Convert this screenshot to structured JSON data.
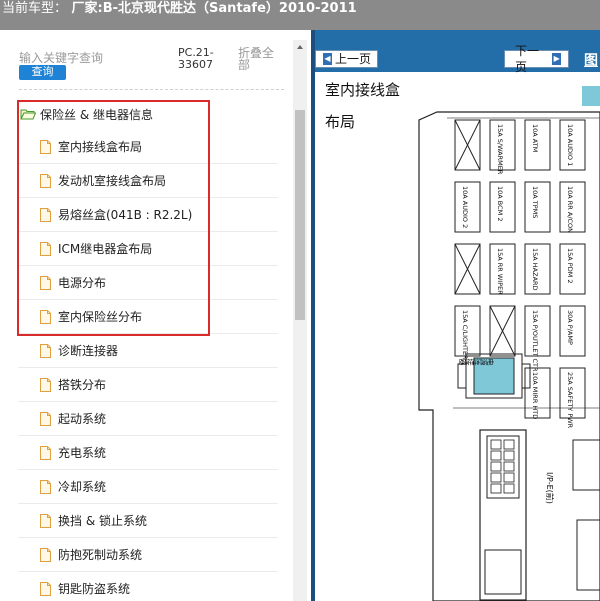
{
  "header": {
    "label": "当前车型：",
    "vehicle": "厂家:B-北京现代胜达（Santafe）2010-2011"
  },
  "search": {
    "placeholder": "输入关键字查询",
    "button_label": "查询",
    "code": "PC.21-33607",
    "fold_label": "折叠全部"
  },
  "tree": {
    "folder_label": "保险丝 & 继电器信息",
    "items": [
      "室内接线盒布局",
      "发动机室接线盒布局",
      "易熔丝盒(041B : R2.2L)",
      "ICM继电器盒布局",
      "电源分布",
      "室内保险丝分布",
      "诊断连接器",
      "搭铁分布",
      "起动系统",
      "充电系统",
      "冷却系统",
      "换挡 & 锁止系统",
      "防抱死制动系统",
      "钥匙防盗系统"
    ]
  },
  "nav": {
    "prev_label": "上一页",
    "next_label": "下一页",
    "extra": "图"
  },
  "page": {
    "title_line1": "室内接线盒",
    "title_line2": "布局"
  },
  "diagram": {
    "fuses": [
      [
        "",
        "15A S/WARMER",
        "10A ATM",
        "10A AUDIO 1"
      ],
      [
        "10A AUDIO 2",
        "10A BCM 2",
        "10A TPMS",
        "10A RR A/CON"
      ],
      [
        "",
        "15A RR WIPER",
        "15A HAZARD",
        "15A PDM 2"
      ],
      [
        "15A C/LIGHTER",
        "",
        "15A P/OUTLET CTR",
        "30A P/AMP"
      ],
      [
        "",
        "",
        "10A MIRR HTD",
        "25A SAFETY PWR"
      ]
    ],
    "relay_label": "电源连接器",
    "connector_label": "I/P-E(前)",
    "colors": {
      "relay_fill": "#7ec8d8",
      "line": "#222222"
    }
  },
  "colors": {
    "header_bg": "#8a8a8a",
    "nav_bg": "#236ea8",
    "button_blue": "#1e83d4",
    "highlight_red": "#d92b2b",
    "splitter": "#1c4f7e"
  }
}
